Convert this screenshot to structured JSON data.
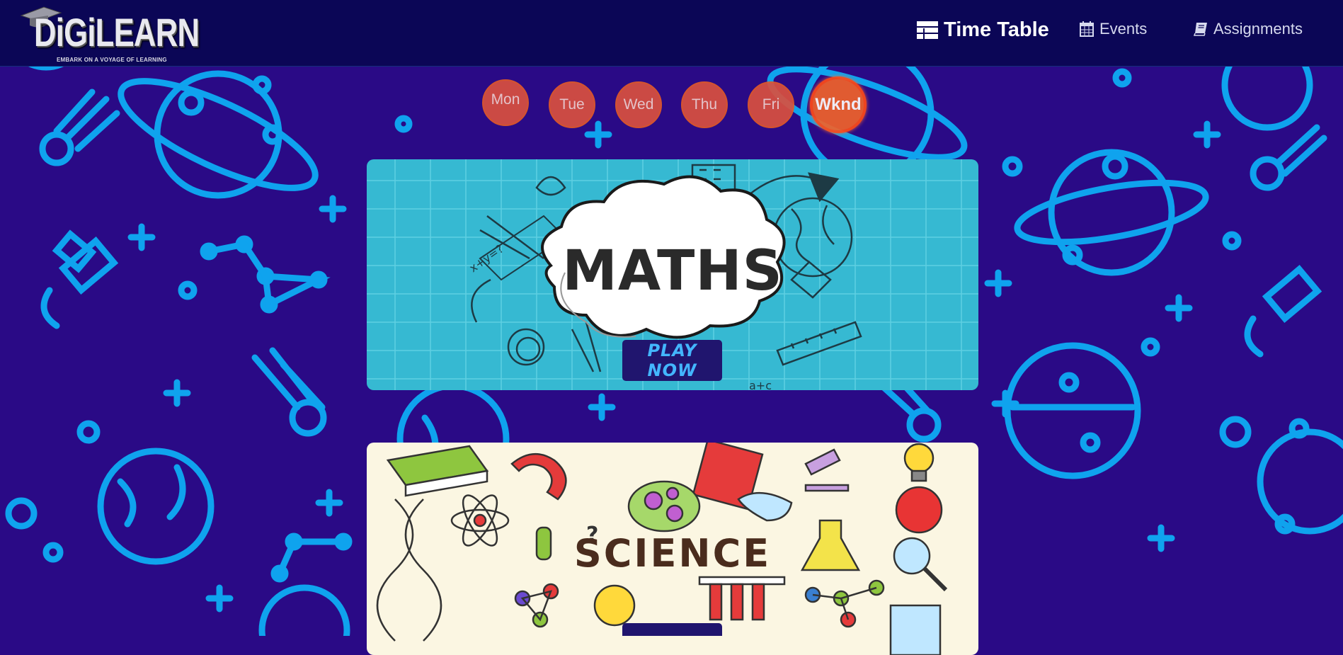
{
  "brand": {
    "name": "DiGiLEARN",
    "tagline": "EMBARK ON A VOYAGE OF LEARNING"
  },
  "nav": {
    "items": [
      {
        "label": "Time Table",
        "icon": "table-icon",
        "active": true
      },
      {
        "label": "Events",
        "icon": "calendar-icon",
        "active": false
      },
      {
        "label": "Assignments",
        "icon": "book-icon",
        "active": false
      }
    ]
  },
  "days": [
    {
      "label": "Mon",
      "active": false
    },
    {
      "label": "Tue",
      "active": false
    },
    {
      "label": "Wed",
      "active": false
    },
    {
      "label": "Thu",
      "active": false
    },
    {
      "label": "Fri",
      "active": false
    },
    {
      "label": "Wknd",
      "active": true
    }
  ],
  "subjects": [
    {
      "title": "MATHS",
      "button": "PLAY NOW"
    },
    {
      "title": "SCIENCE",
      "button": ""
    }
  ],
  "colors": {
    "background": "#2a0a86",
    "pattern": "#0fa3ee",
    "navbar": "#0b0656",
    "day_circle": "#d9503f",
    "day_active": "#f0622a",
    "maths_card": "#36b9d2",
    "science_card": "#fbf6e2",
    "button_bg": "#20156e",
    "button_text": "#43b6ff"
  }
}
